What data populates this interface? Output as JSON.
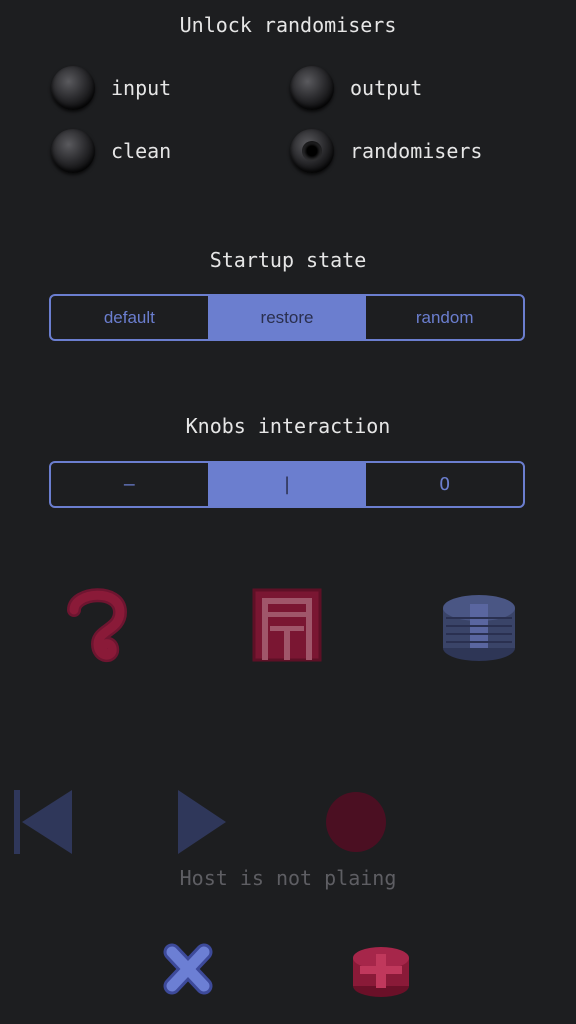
{
  "unlock": {
    "title": "Unlock randomisers",
    "toggles": [
      {
        "label": "input",
        "on": false
      },
      {
        "label": "output",
        "on": false
      },
      {
        "label": "clean",
        "on": false
      },
      {
        "label": "randomisers",
        "on": true
      }
    ]
  },
  "startup": {
    "title": "Startup state",
    "options": [
      "default",
      "restore",
      "random"
    ],
    "selected": "restore"
  },
  "knobs": {
    "title": "Knobs interaction",
    "options": [
      "—",
      "|",
      "O"
    ],
    "selected": "|"
  },
  "icons": {
    "help": "help-icon",
    "preset": "preset-icon",
    "layers": "layers-icon",
    "skip_back": "skip-back-icon",
    "play": "play-icon",
    "record": "record-icon",
    "close": "close-icon",
    "stack": "stack-icon"
  },
  "colors": {
    "background": "#1d1e20",
    "accent": "#6b7ecf",
    "crimson": "#8a1a38",
    "dim_blue": "#3a4468"
  },
  "transport": {
    "status": "Host is not plaing"
  }
}
